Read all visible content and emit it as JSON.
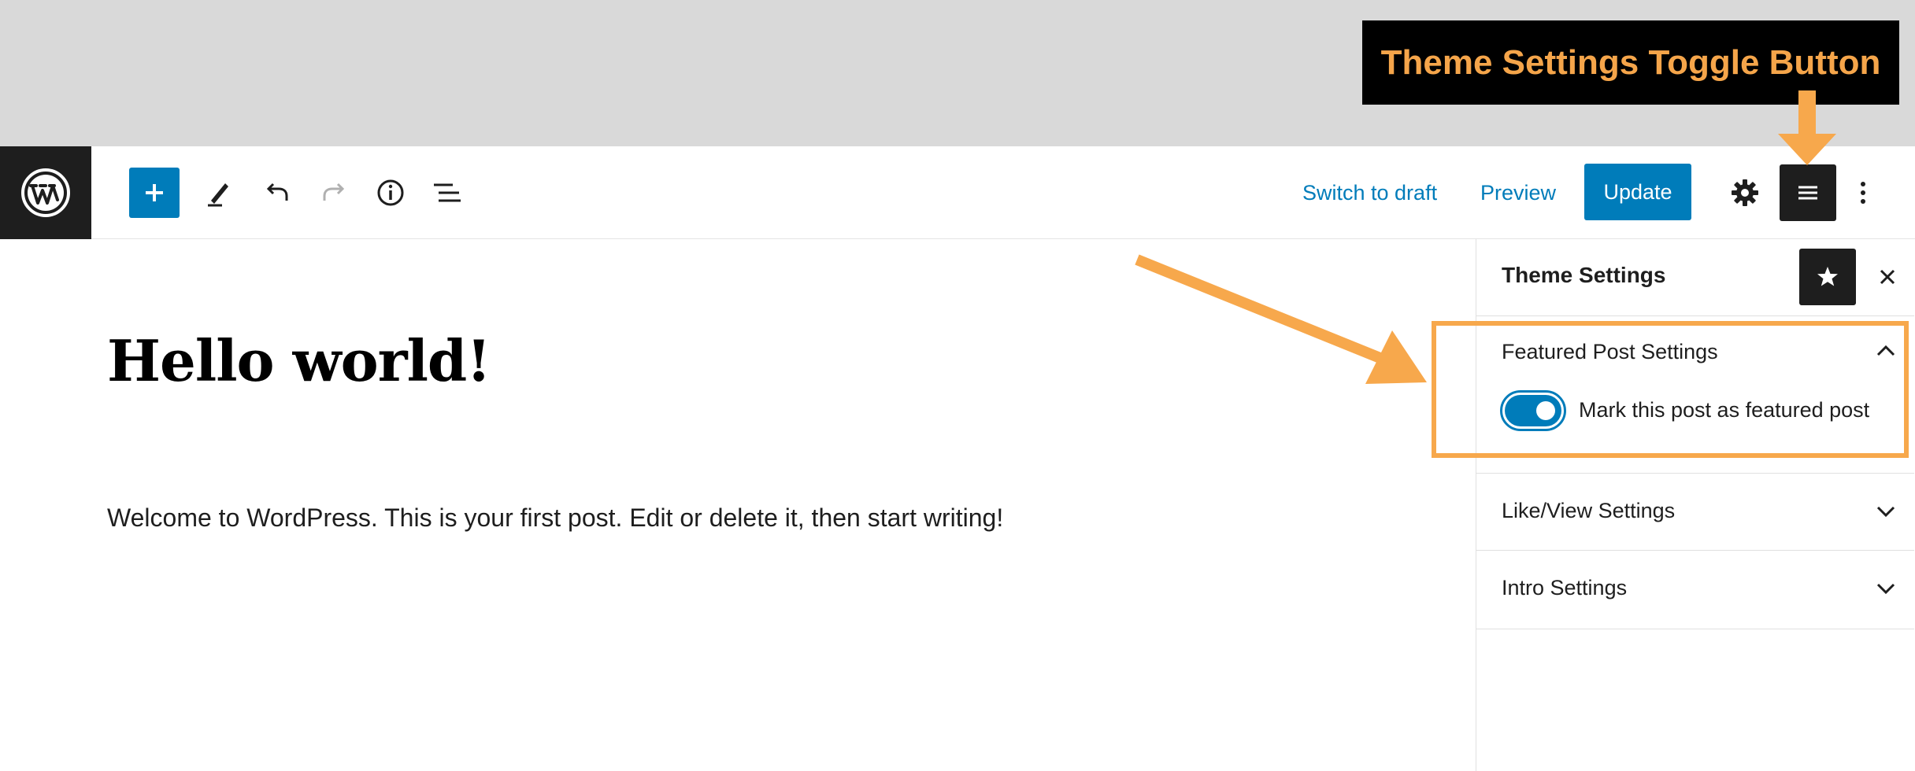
{
  "annotation": {
    "callout_text": "Theme Settings Toggle Button",
    "accent_color": "#f7a84c"
  },
  "toolbar": {
    "switch_to_draft_label": "Switch to draft",
    "preview_label": "Preview",
    "update_label": "Update",
    "icons": [
      "wordpress-logo",
      "plus-icon",
      "pencil-icon",
      "undo-icon",
      "redo-icon",
      "info-icon",
      "list-view-icon",
      "gear-icon",
      "hamburger-menu-icon",
      "more-vertical-icon"
    ]
  },
  "editor": {
    "post_title": "Hello world!",
    "post_body": "Welcome to WordPress. This is your first post. Edit or delete it, then start writing!"
  },
  "sidebar": {
    "title": "Theme Settings",
    "panels": [
      {
        "label": "Featured Post Settings",
        "expanded": true,
        "toggle": {
          "label": "Mark this post as featured post",
          "checked": true
        }
      },
      {
        "label": "Like/View Settings",
        "expanded": false
      },
      {
        "label": "Intro Settings",
        "expanded": false
      }
    ]
  },
  "colors": {
    "primary": "#007cba",
    "dark": "#1e1e1e",
    "top_band": "#d9d9d9"
  }
}
